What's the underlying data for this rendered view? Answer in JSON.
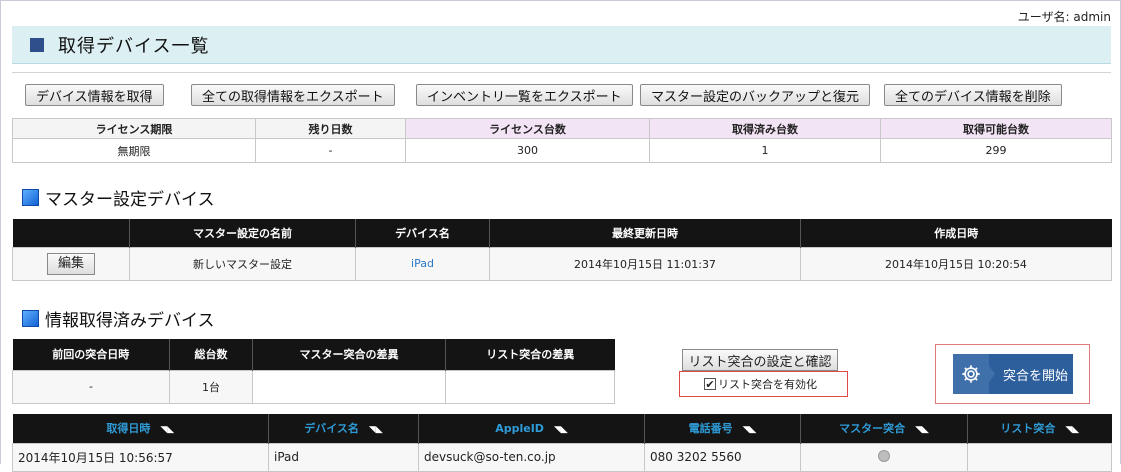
{
  "header": {
    "user_label": "ユーザ名: admin",
    "page_title": "取得デバイス一覧"
  },
  "toolbar": {
    "buttons": [
      "デバイス情報を取得",
      "全ての取得情報をエクスポート",
      "インベントリ一覧をエクスポート",
      "マスター設定のバックアップと復元",
      "全てのデバイス情報を削除"
    ]
  },
  "license": {
    "headers": [
      "ライセンス期限",
      "残り日数",
      "ライセンス台数",
      "取得済み台数",
      "取得可能台数"
    ],
    "values": [
      "無期限",
      "-",
      "300",
      "1",
      "299"
    ]
  },
  "master_section": {
    "title": "マスター設定デバイス",
    "headers": [
      "",
      "マスター設定の名前",
      "デバイス名",
      "最終更新日時",
      "作成日時"
    ],
    "row": {
      "edit_label": "編集",
      "name": "新しいマスター設定",
      "device": "iPad",
      "updated": "2014年10月15日  11:01:37",
      "created": "2014年10月15日  10:20:54"
    }
  },
  "info_section": {
    "title": "情報取得済みデバイス",
    "headers": [
      "前回の突合日時",
      "総台数",
      "マスター突合の差異",
      "リスト突合の差異"
    ],
    "values": [
      "-",
      "1台",
      "",
      ""
    ],
    "list_settings_label": "リスト突合の設定と確認",
    "enable_list_label": "リスト突合を有効化",
    "enable_list_checked": true,
    "start_label": "突合を開始"
  },
  "device_list": {
    "headers": [
      "取得日時",
      "デバイス名",
      "AppleID",
      "電話番号",
      "マスター突合",
      "リスト突合"
    ],
    "rows": [
      [
        "2014年10月15日  10:56:57",
        "iPad",
        "devsuck@so-ten.co.jp",
        "080 3202 5560",
        "",
        ""
      ]
    ]
  },
  "icons": {
    "sort": "sort-arrow-icon",
    "gear": "gear-icon",
    "status": "status-dot-icon"
  }
}
